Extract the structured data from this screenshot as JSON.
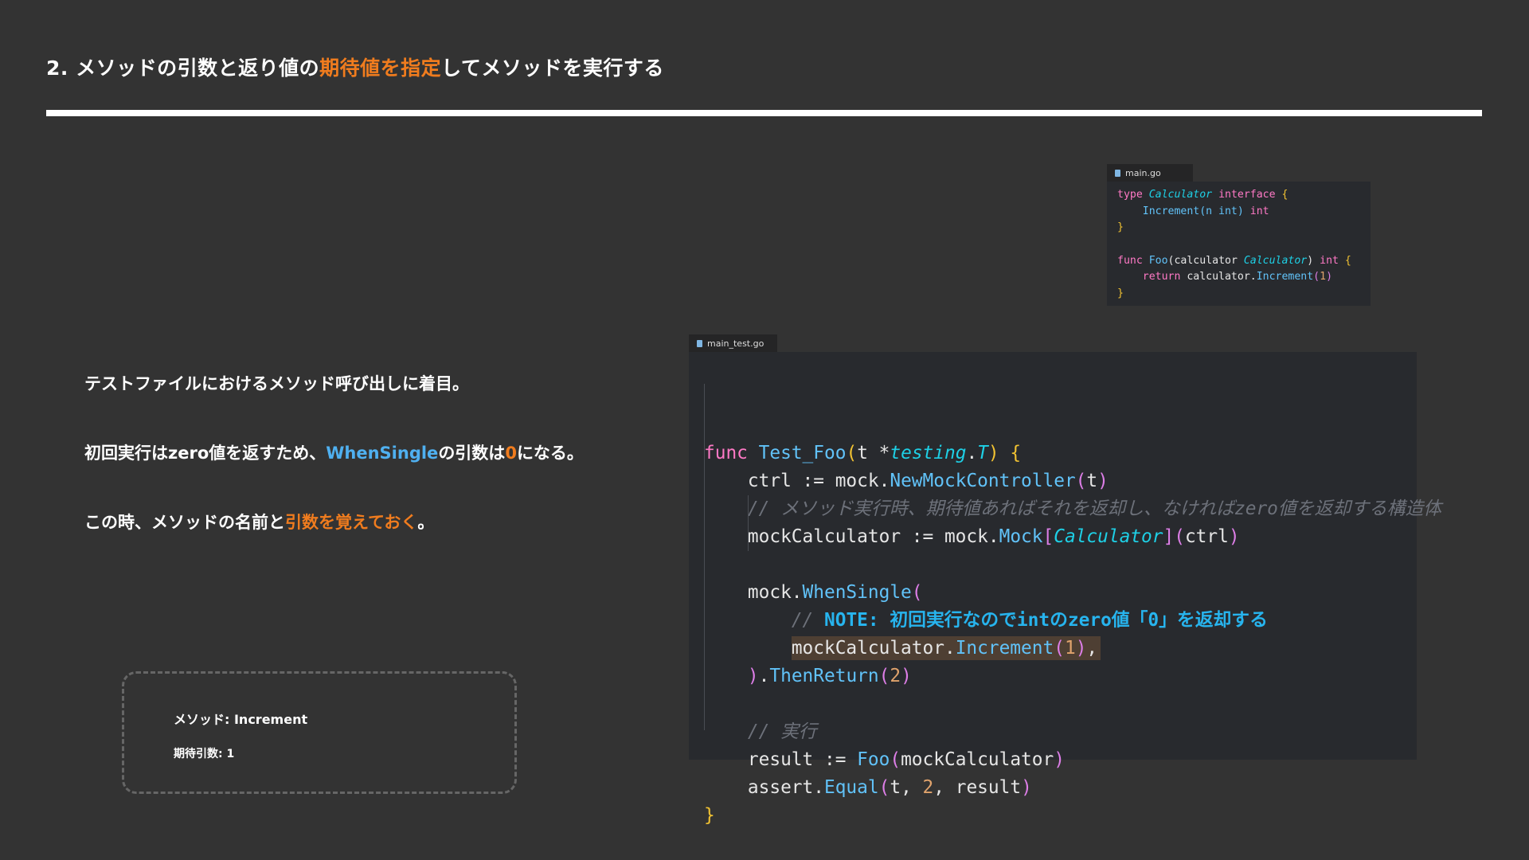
{
  "title": {
    "part1": "2. メソッドの引数と返り値の",
    "highlight": "期待値を指定",
    "part2": "してメソッドを実行する"
  },
  "descriptions": {
    "line1": "テストファイルにおけるメソッド呼び出しに着目。",
    "line2_part1": "初回実行はzero値を返すため、",
    "line2_highlight1": "WhenSingle",
    "line2_part2": "の引数は",
    "line2_highlight2": "0",
    "line2_part3": "になる。",
    "line3_part1": "この時、メソッドの名前と",
    "line3_highlight": "引数を覚えておく",
    "line3_part2": "。"
  },
  "note_box": {
    "method": "メソッド: Increment",
    "expected_arg": "期待引数: 1"
  },
  "small_editor": {
    "tab_label": "main.go",
    "tokens": {
      "type_kw": "type",
      "calculator": "Calculator",
      "interface_kw": "interface",
      "open_brace": "{",
      "close_brace": "}",
      "increment": "Increment",
      "increment_params": "(n int)",
      "int": "int",
      "func_kw": "func",
      "foo": "Foo",
      "foo_params_open": "(calculator ",
      "foo_params_close": ")",
      "return_kw": "return",
      "calc_var": "calculator.",
      "call_args_open": "(",
      "one": "1",
      "call_args_close": ")"
    }
  },
  "big_editor": {
    "tab_label": "main_test.go",
    "tokens": {
      "func_kw": "func",
      "test_name": "Test_Foo",
      "t_param": "t *",
      "testing": "testing",
      "dot": ".",
      "T": "T",
      "open_paren": "(",
      "close_paren": ")",
      "open_brace": "{",
      "close_brace": "}",
      "ctrl_assign": "ctrl := mock.",
      "new_ctrl": "NewMockController",
      "t_arg": "t",
      "comment1": "// メソッド実行時、期待値あればそれを返却し、なければzero値を返却する構造体",
      "mock_calc_assign": "mockCalculator := mock.",
      "mock_fn": "Mock",
      "open_bracket": "[",
      "close_bracket": "]",
      "calculator": "Calculator",
      "ctrl_arg": "ctrl",
      "mock_dot": "mock.",
      "when_single": "WhenSingle",
      "comment2_prefix": "// ",
      "comment2_note": "NOTE: 初回実行なのでintのzero値「0」を返却する",
      "mock_calc_dot": "mockCalculator.",
      "increment": "Increment",
      "one": "1",
      "comma": ",",
      "then_return": "ThenReturn",
      "two": "2",
      "comment3": "// 実行",
      "result_assign": "result := ",
      "foo": "Foo",
      "mock_calc_arg": "mockCalculator",
      "assert_dot": "assert.",
      "equal": "Equal",
      "t_comma": "t, ",
      "result_arg": "result"
    }
  }
}
